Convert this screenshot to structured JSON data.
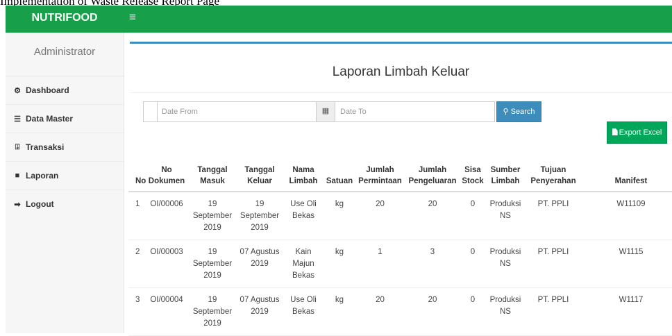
{
  "caption": "Implementation of Waste Release Report Page",
  "topbar": {
    "brand": "NUTRIFOOD",
    "menu_icon": "hamburger-icon",
    "color": "#17a049"
  },
  "sidebar": {
    "user": "Administrator",
    "items": [
      {
        "label": "Dashboard",
        "icon": "dashboard-icon",
        "glyph": "⚙"
      },
      {
        "label": "Data Master",
        "icon": "data-master-icon",
        "glyph": "☰"
      },
      {
        "label": "Transaksi",
        "icon": "transaksi-icon",
        "glyph": "⎗"
      },
      {
        "label": "Laporan",
        "icon": "laporan-icon",
        "glyph": "■"
      },
      {
        "label": "Logout",
        "icon": "logout-icon",
        "glyph": "➡"
      }
    ]
  },
  "main": {
    "title": "Laporan Limbah Keluar",
    "date_from_placeholder": "Date From",
    "date_to_placeholder": "Date To",
    "search_label": "Search",
    "export_label": "Export Excel",
    "accent": "#3c8dbc",
    "export_color": "#00a65a"
  },
  "table": {
    "headers": [
      "No",
      "No Dokumen",
      "Tanggal Masuk",
      "Tanggal Keluar",
      "Nama Limbah",
      "Satuan",
      "Jumlah Permintaan",
      "Jumlah Pengeluaran",
      "Sisa Stock",
      "Sumber Limbah",
      "Tujuan Penyerahan",
      "Manifest"
    ],
    "rows": [
      [
        "1",
        "OI/00006",
        "19 September 2019",
        "19 September 2019",
        "Use Oli Bekas",
        "kg",
        "20",
        "20",
        "0",
        "Produksi NS",
        "PT. PPLI",
        "W11109"
      ],
      [
        "2",
        "OI/00003",
        "19 September 2019",
        "07 Agustus 2019",
        "Kain Majun Bekas",
        "kg",
        "1",
        "3",
        "0",
        "Produksi NS",
        "PT. PPLI",
        "W1115"
      ],
      [
        "3",
        "OI/00004",
        "19 September 2019",
        "07 Agustus 2019",
        "Use Oli Bekas",
        "kg",
        "20",
        "20",
        "0",
        "Produksi NS",
        "PT. PPLI",
        "W1117"
      ]
    ]
  }
}
